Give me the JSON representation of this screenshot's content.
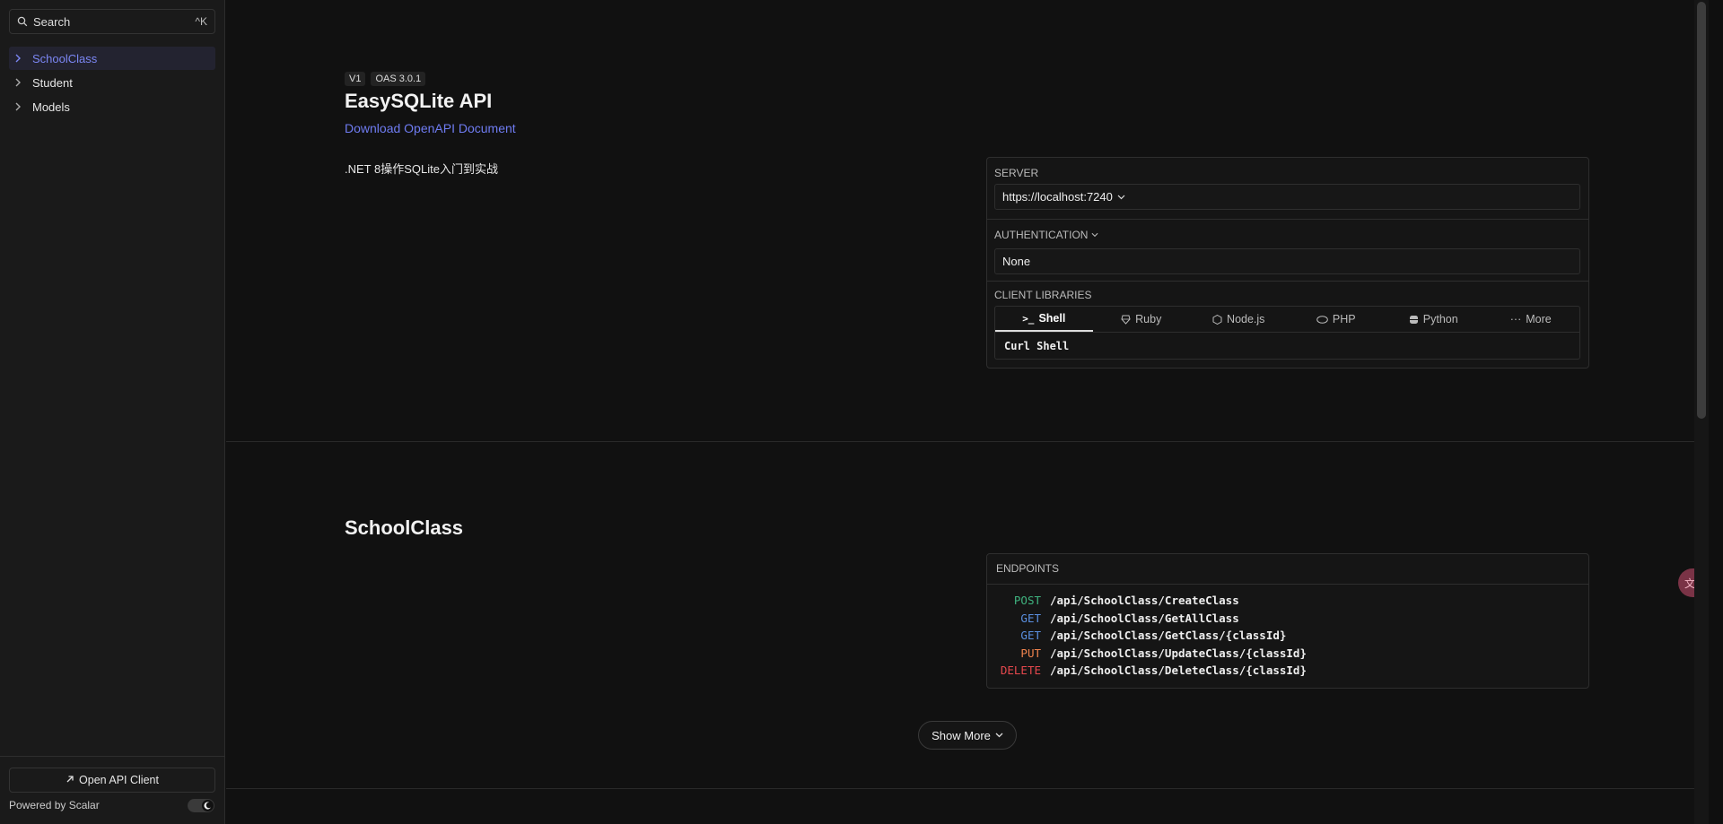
{
  "sidebar": {
    "search_label": "Search",
    "search_shortcut": "^K",
    "items": [
      {
        "label": "SchoolClass"
      },
      {
        "label": "Student"
      },
      {
        "label": "Models"
      }
    ],
    "open_client_label": "Open API Client",
    "powered_by": "Powered by Scalar"
  },
  "info": {
    "version_badge": "V1",
    "oas_badge": "OAS 3.0.1",
    "title": "EasySQLite API",
    "download_link": "Download OpenAPI Document",
    "description": ".NET 8操作SQLite入门到实战"
  },
  "server_card": {
    "server_label": "SERVER",
    "server_url": "https://localhost:7240",
    "auth_label": "AUTHENTICATION",
    "auth_value": "None",
    "client_label": "CLIENT LIBRARIES",
    "tabs": [
      {
        "label": "Shell",
        "icon": "terminal-icon"
      },
      {
        "label": "Ruby",
        "icon": "ruby-icon"
      },
      {
        "label": "Node.js",
        "icon": "nodejs-icon"
      },
      {
        "label": "PHP",
        "icon": "php-icon"
      },
      {
        "label": "Python",
        "icon": "python-icon"
      },
      {
        "label": "More",
        "icon": "more-icon"
      }
    ],
    "client_selected": "Curl Shell"
  },
  "section": {
    "title": "SchoolClass",
    "endpoints_label": "ENDPOINTS",
    "endpoints": [
      {
        "method": "POST",
        "path": "/api/SchoolClass/CreateClass"
      },
      {
        "method": "GET",
        "path": "/api/SchoolClass/GetAllClass"
      },
      {
        "method": "GET",
        "path": "/api/SchoolClass/GetClass/{classId}"
      },
      {
        "method": "PUT",
        "path": "/api/SchoolClass/UpdateClass/{classId}"
      },
      {
        "method": "DELETE",
        "path": "/api/SchoolClass/DeleteClass/{classId}"
      }
    ],
    "show_more_label": "Show More"
  },
  "translate_icon": "文A",
  "colors": {
    "accent": "#6f7cf2",
    "post": "#3fb37f",
    "get": "#5a8fe0",
    "put": "#f0834d",
    "delete": "#e5484d"
  }
}
